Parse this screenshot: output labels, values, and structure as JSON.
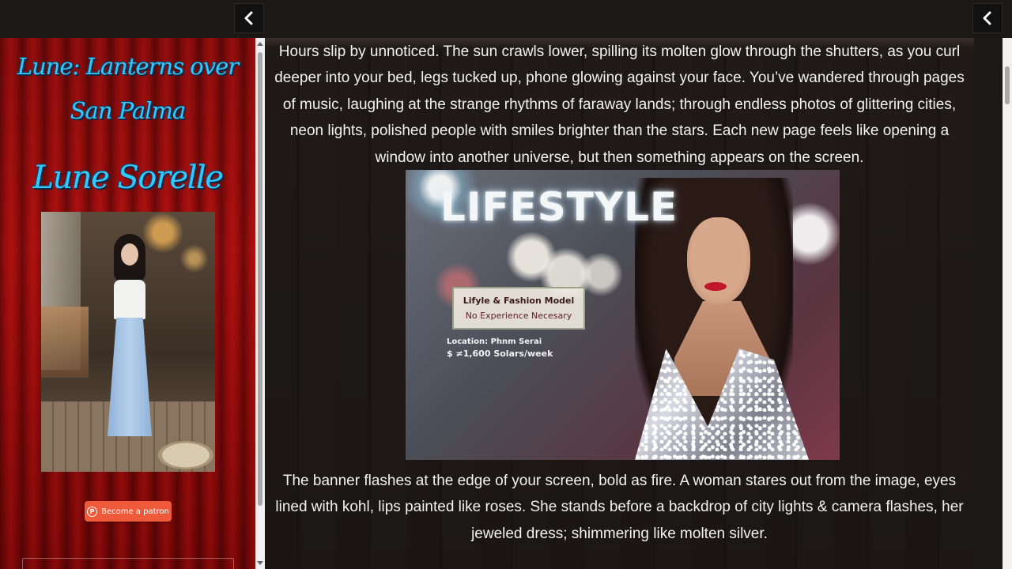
{
  "sidebar": {
    "story_title": "Lune: Lanterns over San Palma",
    "character_name": "Lune Sorelle",
    "patron_button_label": "Become a patron",
    "portrait_icon": "character-portrait"
  },
  "controls": {
    "left_toggle_icon": "chevron-left-icon",
    "right_toggle_icon": "chevron-left-icon"
  },
  "story": {
    "paragraph_1": "Hours slip by unnoticed. The sun crawls lower, spilling its molten glow through the shutters, as you curl deeper into your bed, legs tucked up, phone glowing against your face. You’ve wandered through pages of music, laughing at the strange rhythms of faraway lands; through endless photos of glittering cities, neon lights, polished people with smiles brighter than the stars. Each new page feels like opening a window into another universe, but then something appears on the screen.",
    "paragraph_2": "The banner flashes at the edge of your screen, bold as fire. A woman stares out from the image, eyes lined with kohl, lips painted like roses. She stands before a backdrop of city lights & camera flashes, her jeweled dress; shimmering like molten silver.",
    "image": {
      "headline": "LIFESTYLE",
      "sign_line_1": "Lifyle & Fashion Model",
      "sign_line_2": "No Experience Necesary",
      "location": "Location: Phnm Serai",
      "pay": "$ ≠1,600 Solars/week"
    }
  }
}
